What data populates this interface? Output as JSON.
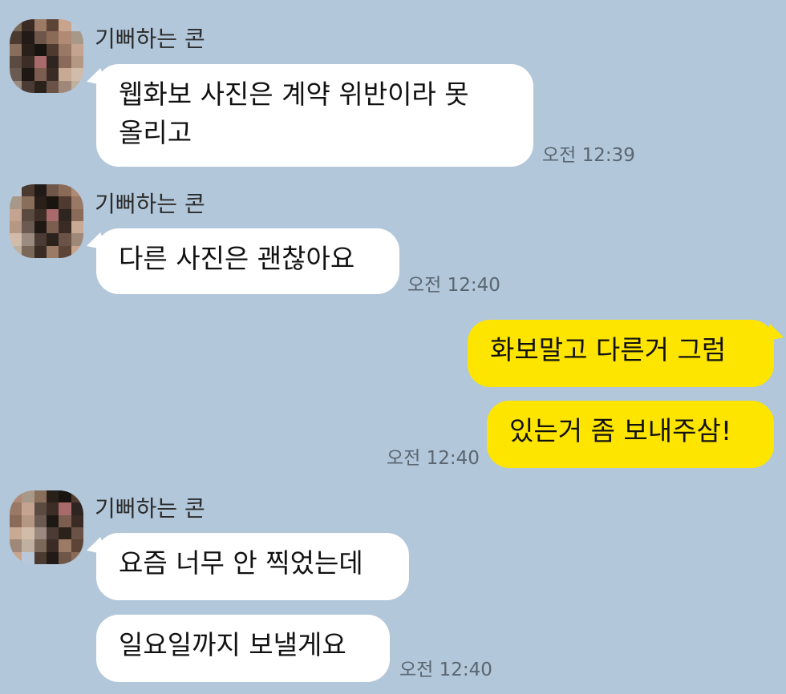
{
  "colors": {
    "background": "#b2c7da",
    "incoming_bubble": "#ffffff",
    "outgoing_bubble": "#fee500"
  },
  "messages": [
    {
      "sender": "기뻐하는 콘",
      "text_lines": [
        "웹화보 사진은 계약 위반이라 못",
        "올리고"
      ],
      "time": "오전 12:39"
    },
    {
      "sender": "기뻐하는 콘",
      "text": "다른 사진은 괜찮아요",
      "time": "오전 12:40"
    },
    {
      "text": "화보말고 다른거 그럼"
    },
    {
      "text": "있는거 좀 보내주삼!",
      "time": "오전 12:40"
    },
    {
      "sender": "기뻐하는 콘",
      "text": "요즘 너무 안 찍었는데"
    },
    {
      "text": "일요일까지 보낼게요",
      "time": "오전 12:40"
    }
  ]
}
